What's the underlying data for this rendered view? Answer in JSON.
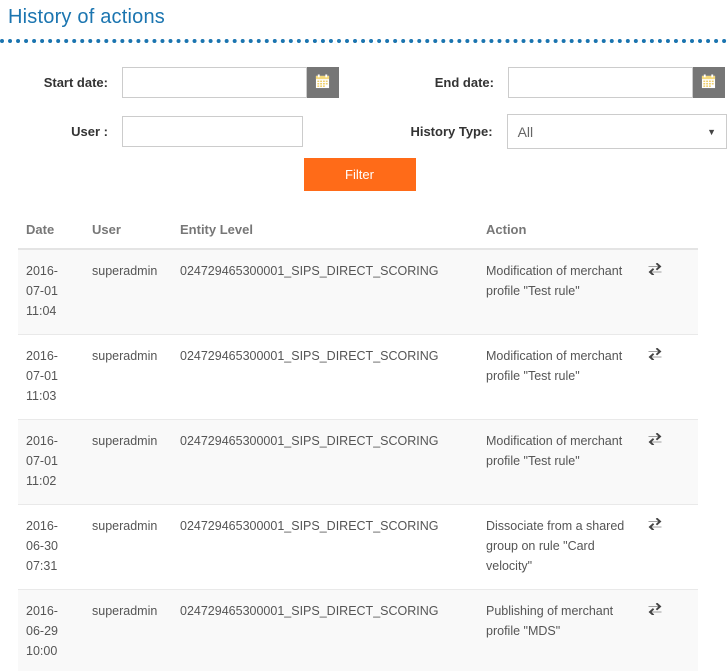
{
  "header": {
    "title": "History of actions"
  },
  "filter_form": {
    "start_date": {
      "label": "Start date:",
      "value": "",
      "placeholder": "",
      "calendar_icon": "calendar-icon"
    },
    "end_date": {
      "label": "End date:",
      "value": "",
      "placeholder": "",
      "calendar_icon": "calendar-icon"
    },
    "user": {
      "label": "User :",
      "value": "",
      "placeholder": ""
    },
    "history_type": {
      "label": "History Type:",
      "selected": "All",
      "caret_icon": "chevron-down-icon"
    },
    "filter_button": "Filter"
  },
  "table": {
    "columns": [
      "Date",
      "User",
      "Entity Level",
      "Action",
      ""
    ],
    "row_icon": "exchange-arrows-icon",
    "rows": [
      {
        "date": "2016-07-01 11:04",
        "user": "superadmin",
        "entity_level": "024729465300001_SIPS_DIRECT_SCORING",
        "action": "Modification of merchant profile \"Test rule\""
      },
      {
        "date": "2016-07-01 11:03",
        "user": "superadmin",
        "entity_level": "024729465300001_SIPS_DIRECT_SCORING",
        "action": "Modification of merchant profile \"Test rule\""
      },
      {
        "date": "2016-07-01 11:02",
        "user": "superadmin",
        "entity_level": "024729465300001_SIPS_DIRECT_SCORING",
        "action": "Modification of merchant profile \"Test rule\""
      },
      {
        "date": "2016-06-30 07:31",
        "user": "superadmin",
        "entity_level": "024729465300001_SIPS_DIRECT_SCORING",
        "action": "Dissociate from a shared group on rule \"Card velocity\""
      },
      {
        "date": "2016-06-29 10:00",
        "user": "superadmin",
        "entity_level": "024729465300001_SIPS_DIRECT_SCORING",
        "action": "Publishing of merchant profile \"MDS\""
      }
    ]
  },
  "colors": {
    "title_blue": "#1b75b0",
    "filter_orange": "#ff6b18",
    "calendar_button_gray": "#767676",
    "row_stripe": "#f9f9f9"
  }
}
